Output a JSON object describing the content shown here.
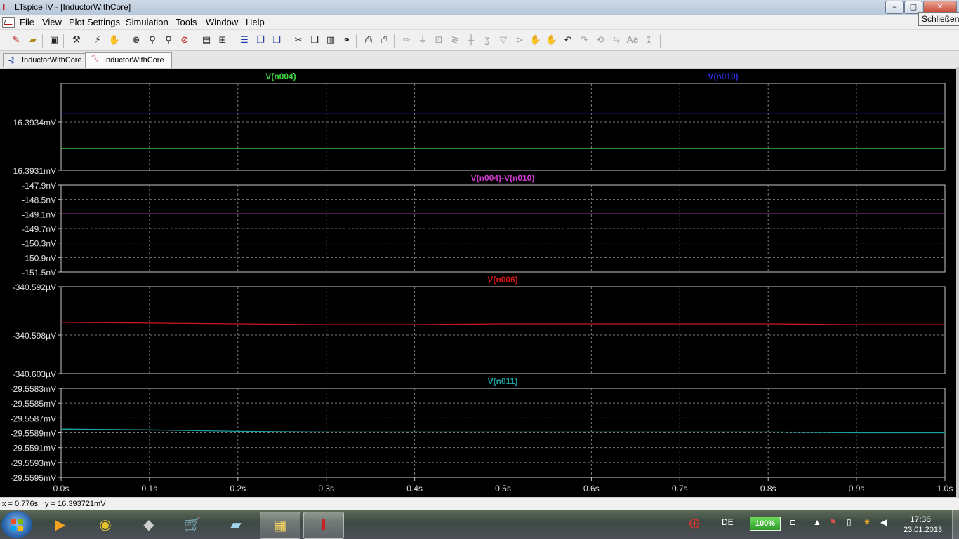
{
  "window": {
    "title": "LTspice IV - [InductorWithCore]",
    "tooltip": "Schließen",
    "controls": {
      "minimize": "–",
      "maximize": "□",
      "close": "✕"
    }
  },
  "menu": [
    "File",
    "View",
    "Plot Settings",
    "Simulation",
    "Tools",
    "Window",
    "Help"
  ],
  "toolbar_icons": [
    "new-schematic-icon",
    "open-icon",
    "save-icon",
    "control-panel-icon",
    "run-icon",
    "pan-hand-icon",
    "zoom-area-icon",
    "zoom-in-icon",
    "zoom-out-icon",
    "zoom-cancel-icon",
    "autorange-icon",
    "fit-icon",
    "tile-horizontal-icon",
    "cascade-icon",
    "tile-vertical-icon",
    "cut-icon",
    "copy-icon",
    "paste-icon",
    "find-icon",
    "print-preview-icon",
    "print-icon",
    "wire-icon",
    "ground-icon",
    "label-net-icon",
    "resistor-icon",
    "capacitor-icon",
    "inductor-icon",
    "diode-icon",
    "component-icon",
    "move-icon",
    "drag-icon",
    "undo-icon",
    "redo-icon",
    "rotate-icon",
    "mirror-icon",
    "text-icon",
    "spice-directive-icon"
  ],
  "tabs": [
    {
      "label": "InductorWithCore",
      "icon": "schematic-tab-icon",
      "active": false
    },
    {
      "label": "InductorWithCore",
      "icon": "waveform-tab-icon",
      "active": true
    }
  ],
  "status": {
    "x": "x = 0.776s",
    "y": "y = 16.393721mV"
  },
  "colors": {
    "plot_bg": "#000000",
    "grid": "#7a7a7a",
    "frame": "#c8c8c8",
    "axis_text": "#e0e0e0",
    "v_n004": "#3fd63f",
    "v_n010": "#2a2ad8",
    "diff": "#d23cd2",
    "v_n006": "#d01818",
    "v_n011": "#1ba3a3"
  },
  "chart_data": [
    {
      "type": "line",
      "x_ticks": [
        "0.0s",
        "0.1s",
        "0.2s",
        "0.3s",
        "0.4s",
        "0.5s",
        "0.6s",
        "0.7s",
        "0.8s",
        "0.9s",
        "1.0s"
      ],
      "xlim": [
        0,
        1
      ],
      "y_ticks": [
        "16.3934mV",
        "16.3931mV"
      ],
      "ylim_mV": [
        16.3931,
        16.3937
      ],
      "series": [
        {
          "name": "V(n004)",
          "color": "#3fd63f",
          "x": [
            0,
            1
          ],
          "y": [
            16.39325,
            16.39325
          ]
        },
        {
          "name": "V(n010)",
          "color": "#2a2ad8",
          "x": [
            0,
            1
          ],
          "y": [
            16.39349,
            16.39349
          ]
        }
      ]
    },
    {
      "type": "line",
      "x_ticks": [
        "0.0s",
        "0.1s",
        "0.2s",
        "0.3s",
        "0.4s",
        "0.5s",
        "0.6s",
        "0.7s",
        "0.8s",
        "0.9s",
        "1.0s"
      ],
      "xlim": [
        0,
        1
      ],
      "y_ticks": [
        "-147.9nV",
        "-148.5nV",
        "-149.1nV",
        "-149.7nV",
        "-150.3nV",
        "-150.9nV",
        "-151.5nV"
      ],
      "ylim_nV": [
        -151.5,
        -147.9
      ],
      "series": [
        {
          "name": "V(n004)-V(n010)",
          "color": "#d23cd2",
          "x": [
            0,
            1
          ],
          "y": [
            -149.1,
            -149.1
          ]
        }
      ]
    },
    {
      "type": "line",
      "x_ticks": [
        "0.0s",
        "0.1s",
        "0.2s",
        "0.3s",
        "0.4s",
        "0.5s",
        "0.6s",
        "0.7s",
        "0.8s",
        "0.9s",
        "1.0s"
      ],
      "xlim": [
        0,
        1
      ],
      "y_ticks": [
        "-340.592µV",
        "-340.598µV",
        "-340.603µV"
      ],
      "ylim_uV": [
        -340.603,
        -340.592
      ],
      "series": [
        {
          "name": "V(n006)",
          "color": "#d01818",
          "x": [
            0,
            0.1,
            0.2,
            0.3,
            0.4,
            0.5,
            0.6,
            0.7,
            0.8,
            0.9,
            1.0
          ],
          "y": [
            -340.5965,
            -340.5966,
            -340.5967,
            -340.5968,
            -340.5968,
            -340.5967,
            -340.5967,
            -340.5967,
            -340.5967,
            -340.5968,
            -340.5968
          ]
        }
      ]
    },
    {
      "type": "line",
      "x_ticks": [
        "0.0s",
        "0.1s",
        "0.2s",
        "0.3s",
        "0.4s",
        "0.5s",
        "0.6s",
        "0.7s",
        "0.8s",
        "0.9s",
        "1.0s"
      ],
      "xlim": [
        0,
        1
      ],
      "y_ticks": [
        "-29.5583mV",
        "-29.5585mV",
        "-29.5587mV",
        "-29.5589mV",
        "-29.5591mV",
        "-29.5593mV",
        "-29.5595mV"
      ],
      "ylim_mV": [
        -29.5595,
        -29.5583
      ],
      "series": [
        {
          "name": "V(n011)",
          "color": "#1ba3a3",
          "x": [
            0,
            0.1,
            0.2,
            0.3,
            0.4,
            0.5,
            0.6,
            0.7,
            0.8,
            0.9,
            1.0
          ],
          "y": [
            -29.55885,
            -29.55886,
            -29.55888,
            -29.55889,
            -29.55889,
            -29.55889,
            -29.55889,
            -29.55889,
            -29.55889,
            -29.5589,
            -29.5589
          ]
        }
      ]
    }
  ],
  "taskbar": {
    "apps": [
      "media-player-icon",
      "chrome-icon",
      "scanner-icon",
      "shopping-cart-icon",
      "notepad-icon",
      "explorer-icon",
      "ltspice-icon"
    ],
    "language": "DE",
    "battery": "100%",
    "time": "17:36",
    "date": "23.01.2013"
  }
}
